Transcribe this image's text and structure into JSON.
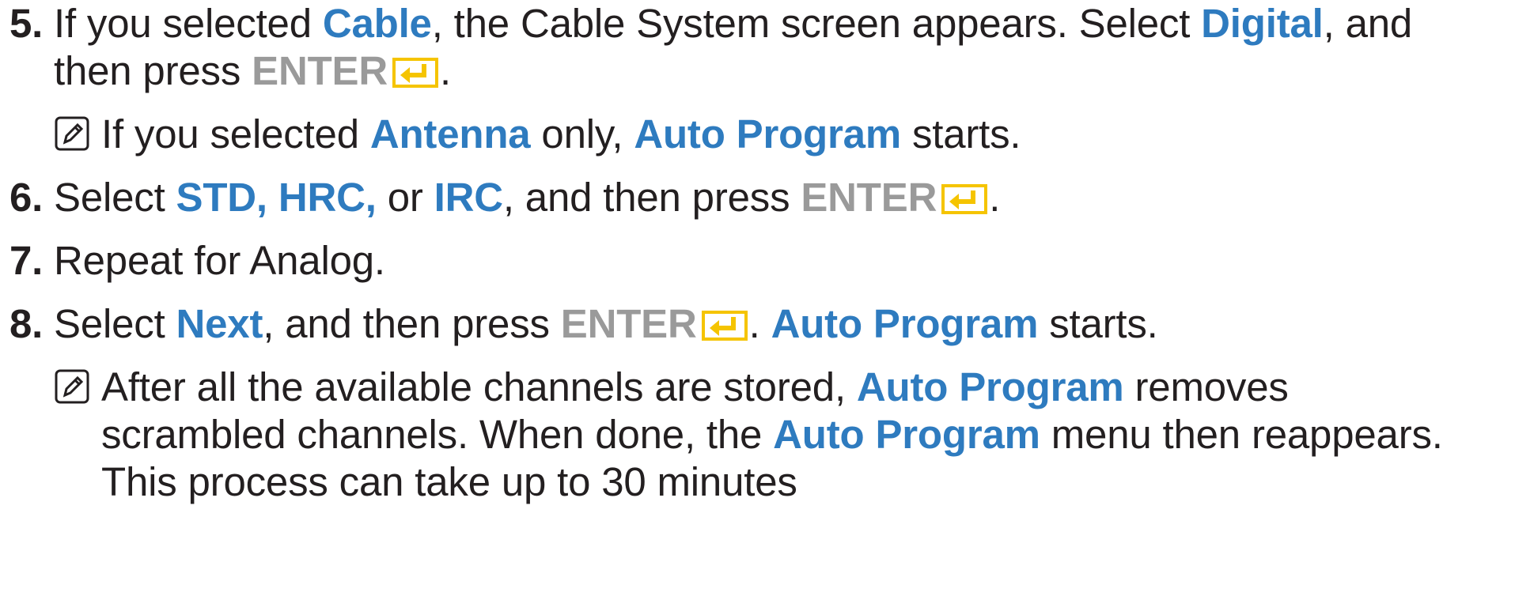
{
  "steps": [
    {
      "number": "5.",
      "line1": {
        "t1": "If you selected ",
        "h1": "Cable",
        "t2": ", the Cable System screen appears. Select ",
        "h2": "Digital",
        "t3": ", and"
      },
      "line2": {
        "t1": "then press ",
        "key": "ENTER",
        "t2": "."
      },
      "note": {
        "t1": "If you selected ",
        "h1": "Antenna",
        "t2": " only, ",
        "h2": "Auto Program",
        "t3": " starts."
      }
    },
    {
      "number": "6.",
      "line1": {
        "t1": "Select ",
        "h1": "STD, HRC,",
        "t2": " or ",
        "h2": "IRC",
        "t3": ", and then press ",
        "key": "ENTER",
        "t4": "."
      }
    },
    {
      "number": "7.",
      "line1": {
        "t1": "Repeat for Analog."
      }
    },
    {
      "number": "8.",
      "line1": {
        "t1": "Select ",
        "h1": "Next",
        "t2": ", and then press ",
        "key": "ENTER",
        "t3": ". ",
        "h2": "Auto Program",
        "t4": " starts."
      },
      "note": {
        "l1_t1": "After all the available channels are stored, ",
        "l1_h1": "Auto Program",
        "l1_t2": " removes",
        "l2_t1": "scrambled channels. When done, the ",
        "l2_h1": "Auto Program",
        "l2_t2": " menu then reappears.",
        "l3_t1": "This process can take up to 30 minutes"
      }
    }
  ],
  "icons": {
    "enter": "enter-key-icon",
    "note": "note-pencil-icon"
  },
  "colors": {
    "text": "#231f20",
    "highlight": "#2e7bbf",
    "key": "#9a9a9a",
    "enter_icon": "#f5c400"
  }
}
